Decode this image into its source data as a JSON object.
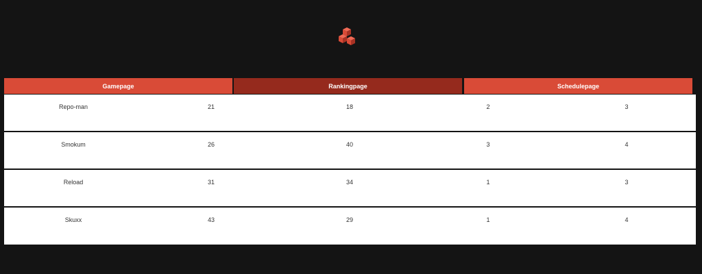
{
  "header": {
    "logo": "cubes-logo-icon",
    "accent_color": "#d94b37",
    "accent_dark": "#952a1d"
  },
  "tabs": [
    {
      "label": "Gamepage"
    },
    {
      "label": "Rankingpage"
    },
    {
      "label": "Schedulepage"
    }
  ],
  "table": {
    "rows": [
      {
        "name": "Repo-man",
        "v1": "21",
        "v2": "18",
        "v3": "2",
        "v4": "3"
      },
      {
        "name": "Smokum",
        "v1": "26",
        "v2": "40",
        "v3": "3",
        "v4": "4"
      },
      {
        "name": "Reload",
        "v1": "31",
        "v2": "34",
        "v3": "1",
        "v4": "3"
      },
      {
        "name": "Skuxx",
        "v1": "43",
        "v2": "29",
        "v3": "1",
        "v4": "4"
      }
    ]
  }
}
